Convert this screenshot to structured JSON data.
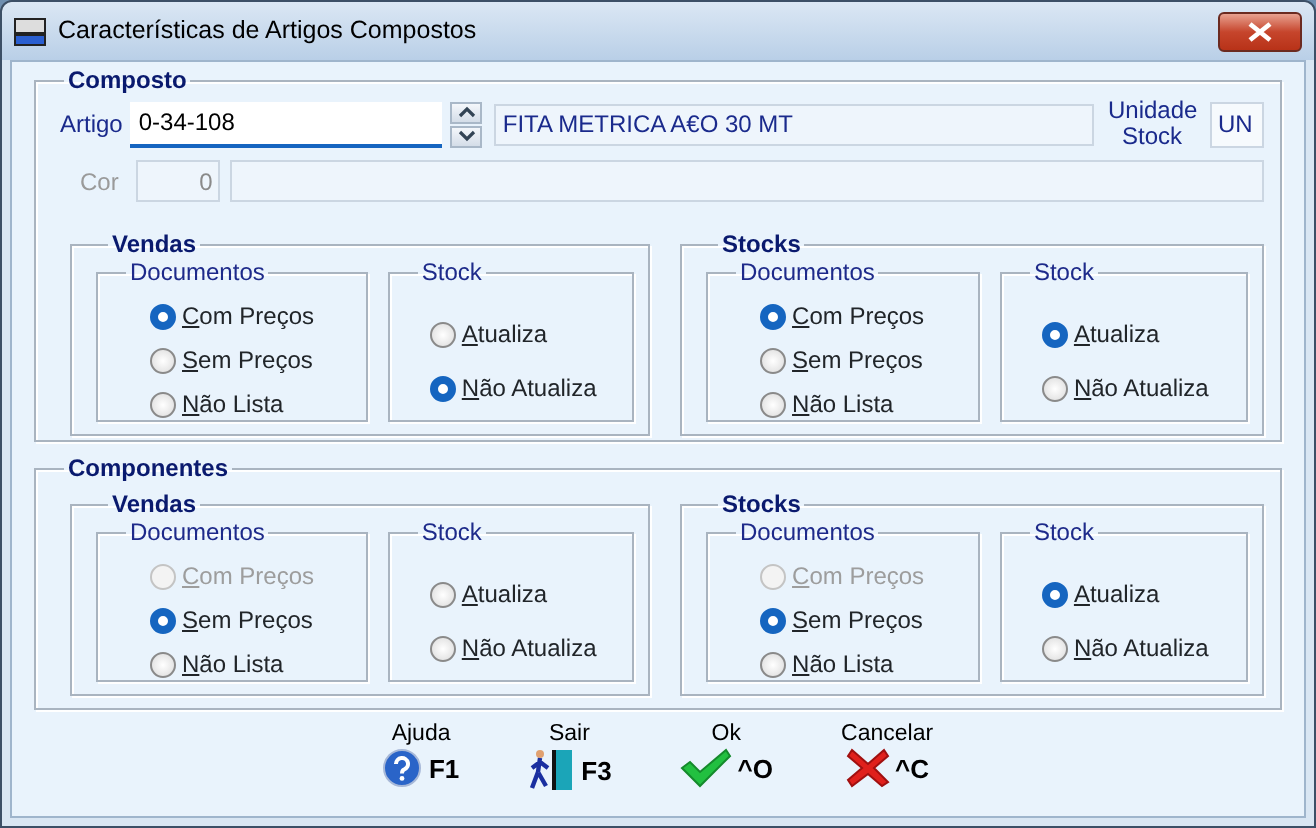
{
  "window": {
    "title": "Características de Artigos Compostos"
  },
  "composto": {
    "title": "Composto",
    "artigo": {
      "label": "Artigo",
      "value": "0-34-108"
    },
    "description": "FITA METRICA A€O 30 MT",
    "unit_label": "Unidade Stock",
    "unit": "UN",
    "cor": {
      "label": "Cor",
      "value": "0",
      "disabled": true
    },
    "panels": [
      {
        "title": "Vendas",
        "groups": [
          {
            "title": "Documentos",
            "kind": "list",
            "options": [
              {
                "label": "Com Preços",
                "selected": true,
                "disabled": false
              },
              {
                "label": "Sem Preços",
                "selected": false,
                "disabled": false
              },
              {
                "label": "Não Lista",
                "selected": false,
                "disabled": false
              }
            ]
          },
          {
            "title": "Stock",
            "kind": "spread",
            "options": [
              {
                "label": "Atualiza",
                "selected": false,
                "disabled": false
              },
              {
                "label": "Não Atualiza",
                "selected": true,
                "disabled": false
              }
            ]
          }
        ]
      },
      {
        "title": "Stocks",
        "groups": [
          {
            "title": "Documentos",
            "kind": "list",
            "options": [
              {
                "label": "Com Preços",
                "selected": true,
                "disabled": false
              },
              {
                "label": "Sem Preços",
                "selected": false,
                "disabled": false
              },
              {
                "label": "Não Lista",
                "selected": false,
                "disabled": false
              }
            ]
          },
          {
            "title": "Stock",
            "kind": "spread",
            "options": [
              {
                "label": "Atualiza",
                "selected": true,
                "disabled": false
              },
              {
                "label": "Não Atualiza",
                "selected": false,
                "disabled": false
              }
            ]
          }
        ]
      }
    ]
  },
  "componentes": {
    "title": "Componentes",
    "panels": [
      {
        "title": "Vendas",
        "groups": [
          {
            "title": "Documentos",
            "kind": "list",
            "options": [
              {
                "label": "Com Preços",
                "selected": false,
                "disabled": true
              },
              {
                "label": "Sem Preços",
                "selected": true,
                "disabled": false
              },
              {
                "label": "Não Lista",
                "selected": false,
                "disabled": false
              }
            ]
          },
          {
            "title": "Stock",
            "kind": "spread",
            "options": [
              {
                "label": "Atualiza",
                "selected": false,
                "disabled": false
              },
              {
                "label": "Não Atualiza",
                "selected": false,
                "disabled": false
              }
            ]
          }
        ]
      },
      {
        "title": "Stocks",
        "groups": [
          {
            "title": "Documentos",
            "kind": "list",
            "options": [
              {
                "label": "Com Preços",
                "selected": false,
                "disabled": true
              },
              {
                "label": "Sem Preços",
                "selected": true,
                "disabled": false
              },
              {
                "label": "Não Lista",
                "selected": false,
                "disabled": false
              }
            ]
          },
          {
            "title": "Stock",
            "kind": "spread",
            "options": [
              {
                "label": "Atualiza",
                "selected": true,
                "disabled": false
              },
              {
                "label": "Não Atualiza",
                "selected": false,
                "disabled": false
              }
            ]
          }
        ]
      }
    ]
  },
  "buttons": [
    {
      "kind": "help",
      "label": "Ajuda",
      "key": "F1"
    },
    {
      "kind": "exit",
      "label": "Sair",
      "key": "F3"
    },
    {
      "kind": "ok",
      "label": "Ok",
      "key": "^O"
    },
    {
      "kind": "cancel",
      "label": "Cancelar",
      "key": "^C"
    }
  ]
}
